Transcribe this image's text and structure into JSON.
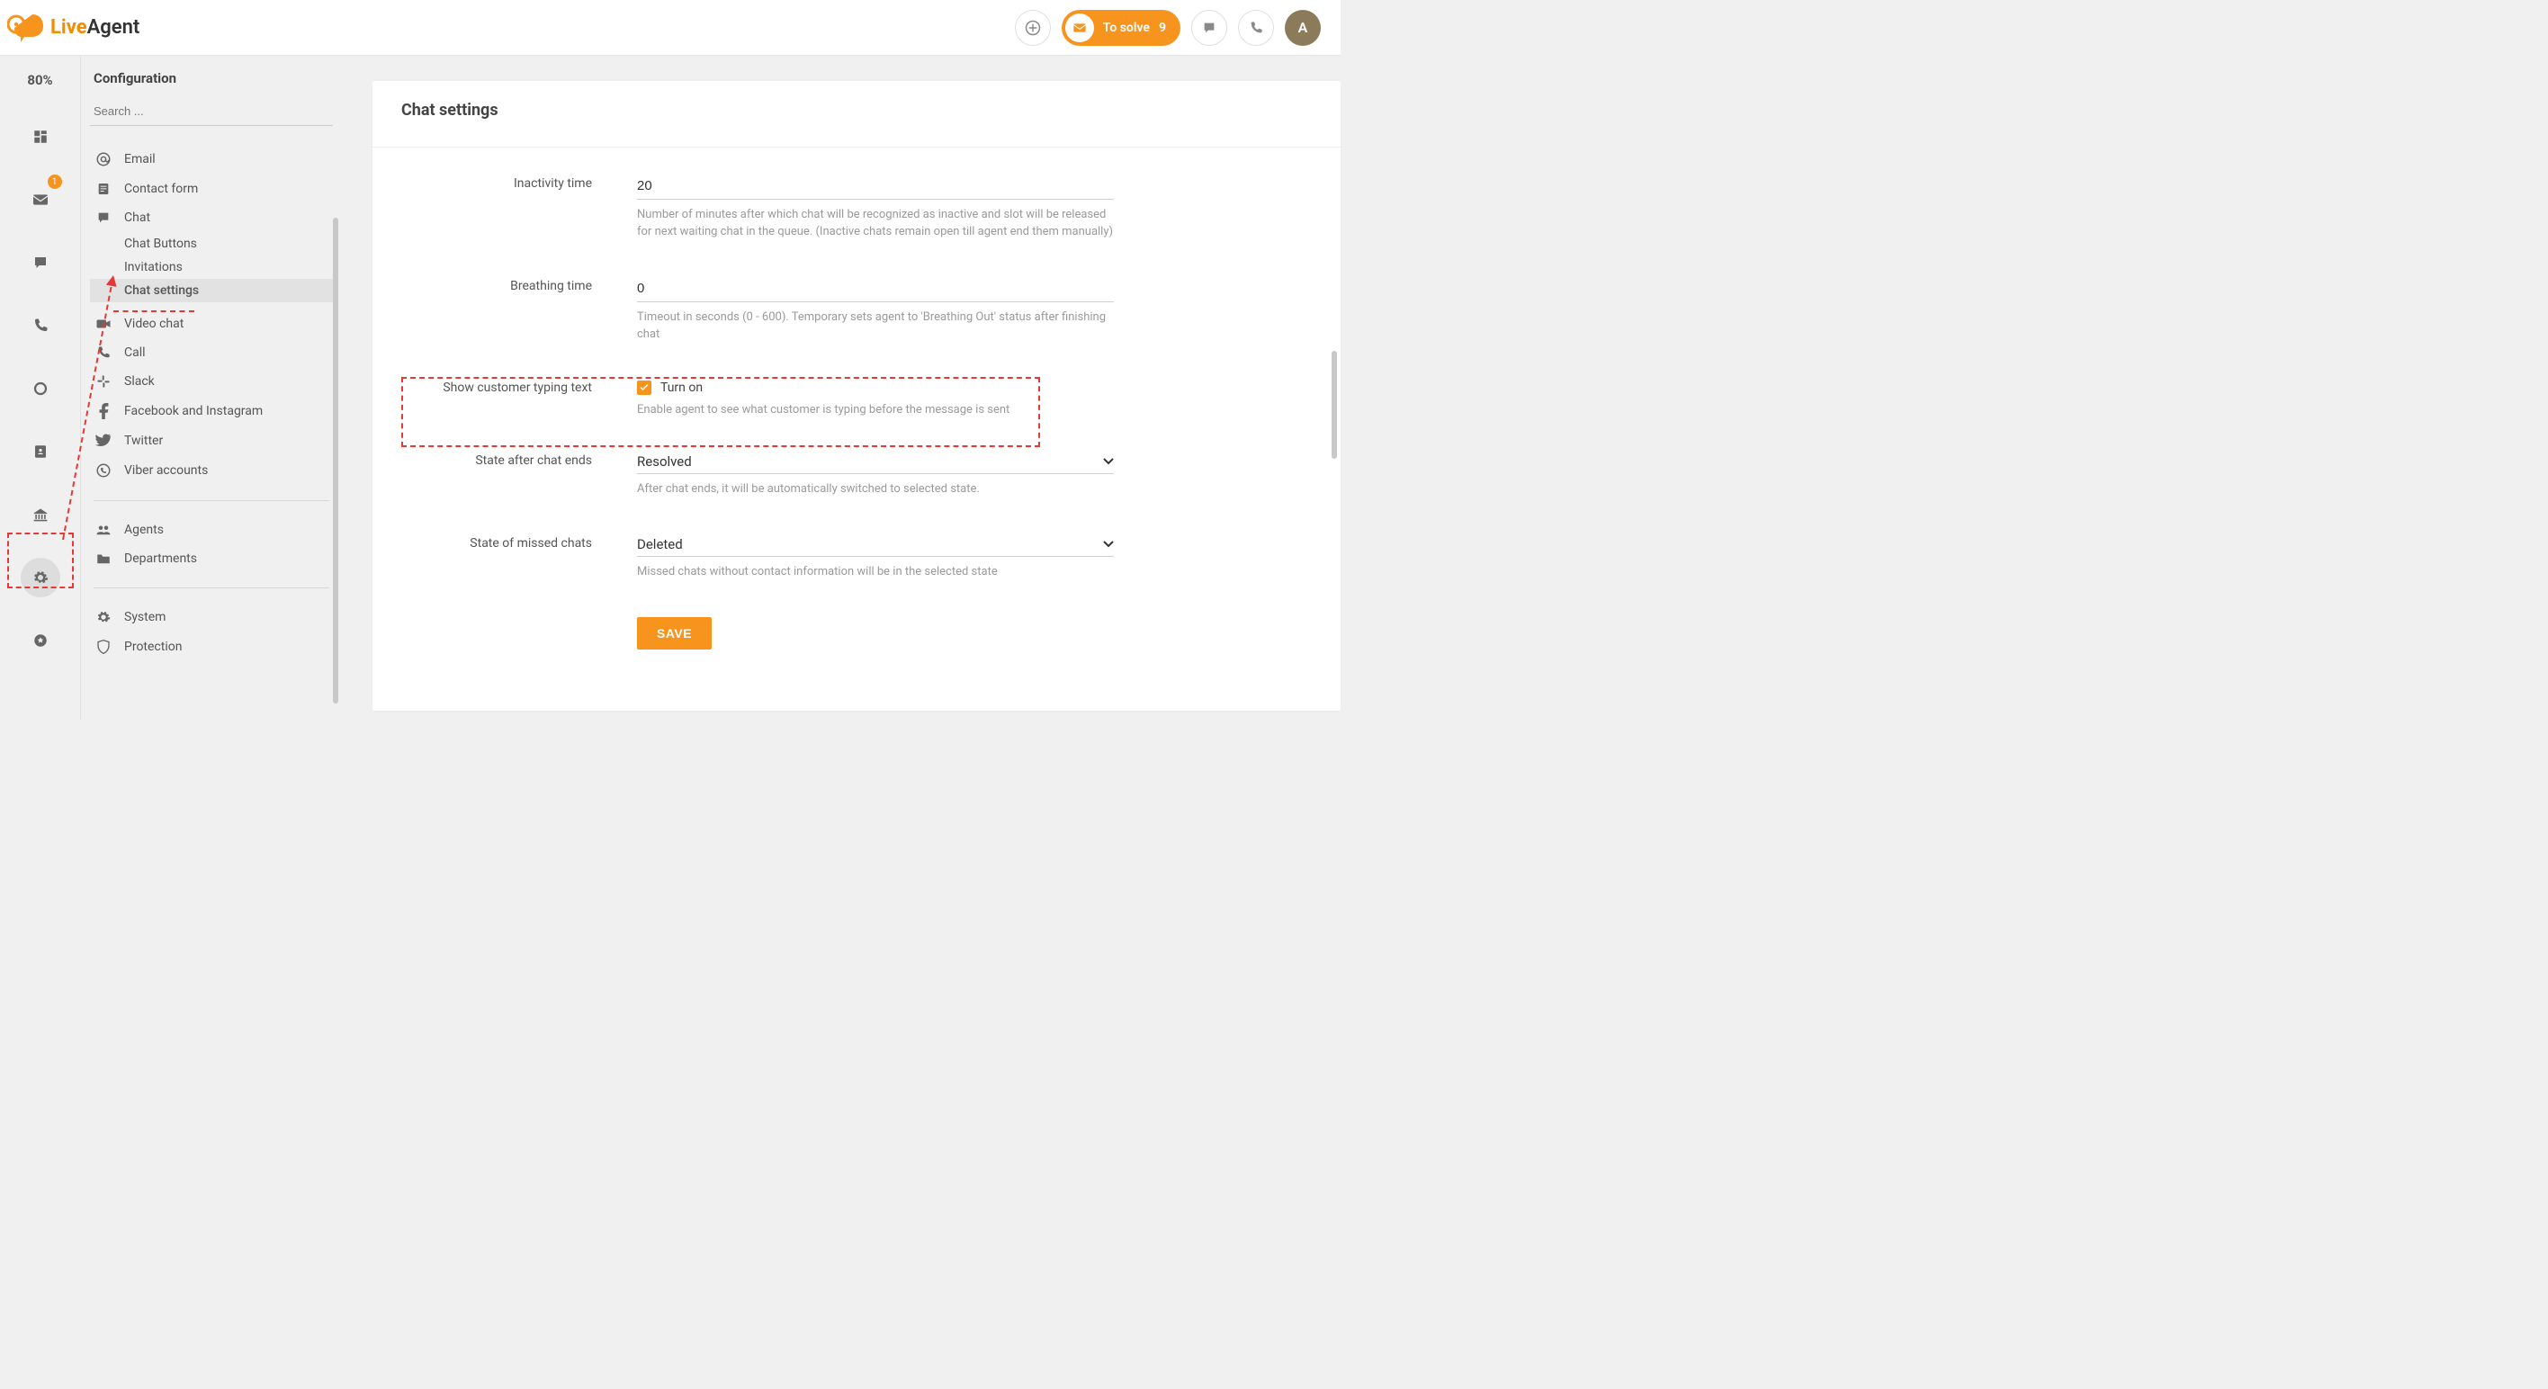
{
  "brand": {
    "word1": "Live",
    "word2": "Agent"
  },
  "header": {
    "to_solve_label": "To solve",
    "to_solve_count": "9",
    "avatar_initial": "A"
  },
  "rail": {
    "progress": "80%",
    "badge_inbox": "1"
  },
  "config": {
    "title": "Configuration",
    "search_placeholder": "Search ...",
    "items": {
      "email": "Email",
      "contact_form": "Contact form",
      "chat": "Chat",
      "chat_buttons": "Chat Buttons",
      "invitations": "Invitations",
      "chat_settings": "Chat settings",
      "video_chat": "Video chat",
      "call": "Call",
      "slack": "Slack",
      "facebook": "Facebook and Instagram",
      "twitter": "Twitter",
      "viber": "Viber accounts",
      "agents": "Agents",
      "departments": "Departments",
      "system": "System",
      "protection": "Protection"
    }
  },
  "page": {
    "title": "Chat settings",
    "inactivity": {
      "label": "Inactivity time",
      "value": "20",
      "help": "Number of minutes after which chat will be recognized as inactive and slot will be released for next waiting chat in the queue. (Inactive chats remain open till agent end them manually)"
    },
    "breathing": {
      "label": "Breathing time",
      "value": "0",
      "help": "Timeout in seconds (0 - 600). Temporary sets agent to 'Breathing Out' status after finishing chat"
    },
    "typing": {
      "label": "Show customer typing text",
      "checkbox_label": "Turn on",
      "help": "Enable agent to see what customer is typing before the message is sent"
    },
    "state_after": {
      "label": "State after chat ends",
      "value": "Resolved",
      "help": "After chat ends, it will be automatically switched to selected state."
    },
    "state_missed": {
      "label": "State of missed chats",
      "value": "Deleted",
      "help": "Missed chats without contact information will be in the selected state"
    },
    "save": "SAVE"
  }
}
